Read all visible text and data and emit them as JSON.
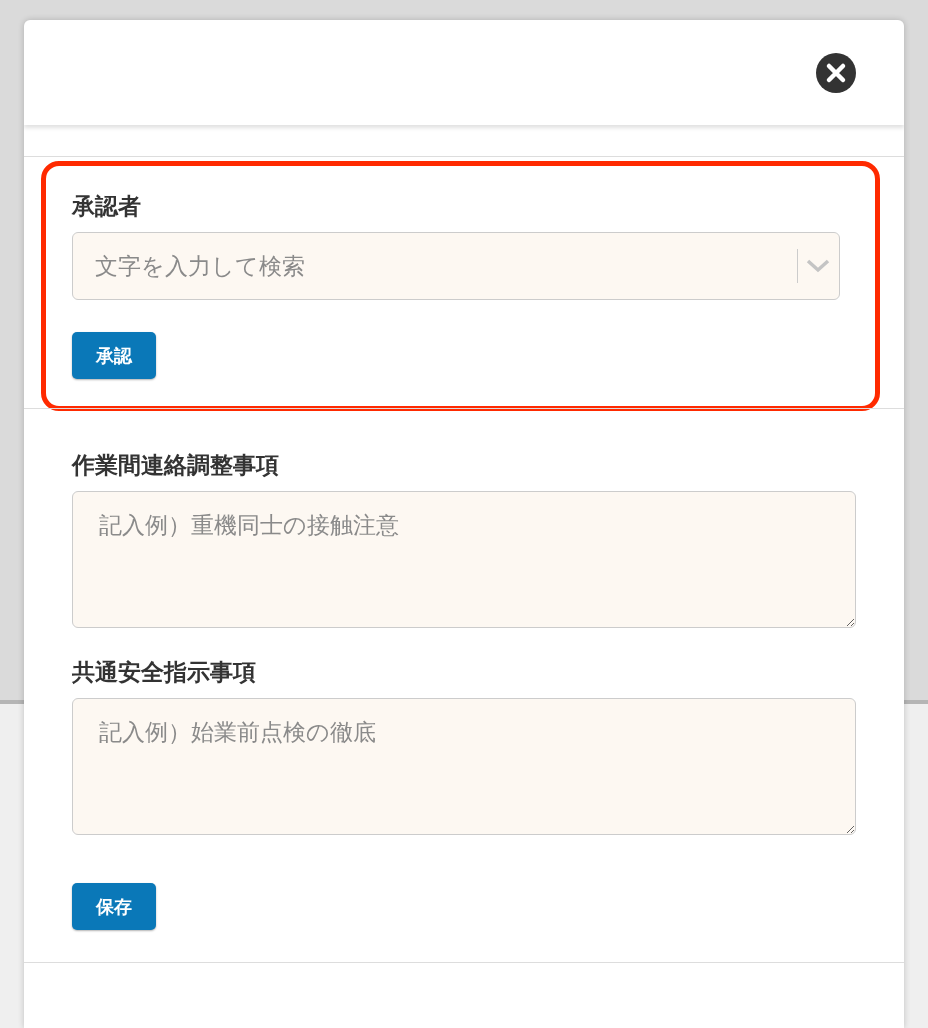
{
  "approver": {
    "label": "承認者",
    "placeholder": "文字を入力して検索",
    "highlighted": true,
    "button": "承認"
  },
  "fields": [
    {
      "label": "作業間連絡調整事項",
      "placeholder": "記入例）重機同士の接触注意"
    },
    {
      "label": "共通安全指示事項",
      "placeholder": "記入例）始業前点検の徹底"
    }
  ],
  "save_button": "保存"
}
